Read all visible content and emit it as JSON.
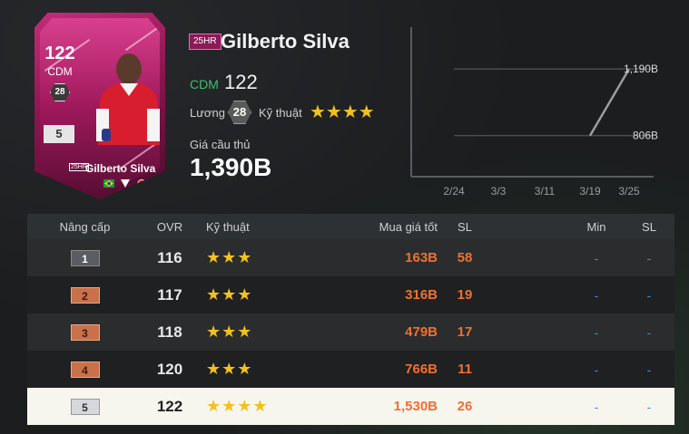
{
  "card": {
    "ovr": "122",
    "position": "CDM",
    "salary_badge": "28",
    "level": "5",
    "name": "Gilberto Silva",
    "season_tag": "25HR"
  },
  "player": {
    "season_tag": "25HR",
    "name": "Gilberto Silva",
    "position": "CDM",
    "ovr": "122",
    "salary_label": "Lương",
    "salary": "28",
    "skill_label": "Kỹ thuật",
    "skill_stars": "★★★★",
    "price_label": "Giá cầu thủ",
    "price": "1,390B"
  },
  "chart_data": {
    "type": "line",
    "x": [
      "2/24",
      "3/3",
      "3/11",
      "3/19",
      "3/25"
    ],
    "series": [
      {
        "values": [
          null,
          null,
          null,
          806,
          1190
        ]
      }
    ],
    "annotations": [
      "1,190B",
      "806B"
    ],
    "grid": true
  },
  "table": {
    "headers": [
      "Nâng cấp",
      "OVR",
      "Kỹ thuật",
      "Mua giá tốt",
      "SL",
      "Min",
      "SL"
    ],
    "rows": [
      {
        "level": "1",
        "ovr": "116",
        "stars": "★★★",
        "buy": "163B",
        "sl": "58",
        "min": "-",
        "sl2": "-"
      },
      {
        "level": "2",
        "ovr": "117",
        "stars": "★★★",
        "buy": "316B",
        "sl": "19",
        "min": "-",
        "sl2": "-"
      },
      {
        "level": "3",
        "ovr": "118",
        "stars": "★★★",
        "buy": "479B",
        "sl": "17",
        "min": "-",
        "sl2": "-"
      },
      {
        "level": "4",
        "ovr": "120",
        "stars": "★★★",
        "buy": "766B",
        "sl": "11",
        "min": "-",
        "sl2": "-"
      },
      {
        "level": "5",
        "ovr": "122",
        "stars": "★★★★",
        "buy": "1,530B",
        "sl": "26",
        "min": "-",
        "sl2": "-"
      }
    ]
  },
  "colors": {
    "accent_green": "#3ac26a",
    "price_orange": "#f07030",
    "star_gold": "#f2c21b",
    "dash_blue": "#3a8fe8",
    "card_pink": "#c42d7a"
  }
}
